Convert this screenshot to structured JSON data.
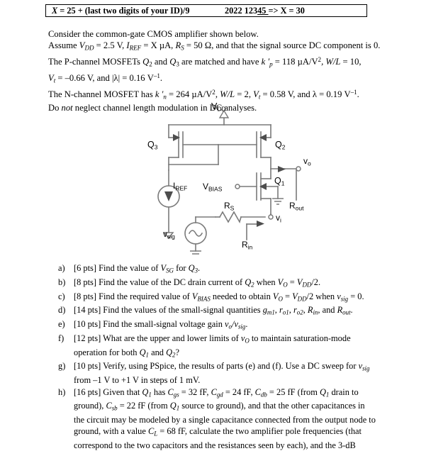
{
  "header": {
    "left_formula": "X = 25 + (last two digits of your ID)/9",
    "right_example_prefix": "2022 123",
    "right_example_underlined": "45 ",
    "right_example_suffix": "=> X = 30"
  },
  "intro": {
    "line1": "Consider the common-gate CMOS amplifier shown below.",
    "line2_parts": {
      "assume": "Assume ",
      "vdd": "V",
      "vdd_sub": "DD",
      "vdd_val": " = 2.5 V, ",
      "iref": "I",
      "iref_sub": "REF",
      "iref_val": " = X µA, ",
      "rs": "R",
      "rs_sub": "S",
      "rs_val": " = 50 Ω, and that the signal source DC component is 0."
    },
    "line3_parts": {
      "pre": "The P-channel MOSFETs ",
      "q2": "Q",
      "q2_sub": "2",
      "mid": " and ",
      "q3": "Q",
      "q3_sub": "3",
      "post": " are matched and have ",
      "kp": "k ′",
      "kp_sub": "p",
      "kp_val": " = 118 µA/V",
      "kp_exp": "2",
      "wl": ", W/L",
      "wl_val": " = 10,"
    },
    "line4_parts": {
      "vt": "V",
      "vt_sub": "t",
      "vt_val": " = –0.66 V, and |λ| = 0.16 V",
      "vt_exp": "–1",
      "end": "."
    },
    "line5_parts": {
      "pre": "The N-channel MOSFET has ",
      "kn": "k ′",
      "kn_sub": "n",
      "kn_val": " = 264 µA/V",
      "kn_exp": "2",
      "wl": ", W/L",
      "wl_val": " = 2, ",
      "vt": "V",
      "vt_sub": "t",
      "vt_val": " = 0.58 V, and λ = 0.19 V",
      "vt_exp": "–1",
      "end": "."
    },
    "line6_a": "Do ",
    "line6_b": "not",
    "line6_c": " neglect channel length modulation in DC analyses."
  },
  "circuit": {
    "vdd_label": "V",
    "vdd_sub": "DD",
    "q3_label": "Q",
    "q3_sub": "3",
    "q2_label": "Q",
    "q2_sub": "2",
    "q1_label": "Q",
    "q1_sub": "1",
    "iref_label": "I",
    "iref_sub": "REF",
    "vbias_label": "V",
    "vbias_sub": "BIAS",
    "vo_label": "v",
    "vo_sub": "o",
    "vi_label": "v",
    "vi_sub": "i",
    "rs_label": "R",
    "rs_sub": "S",
    "rout_label": "R",
    "rout_sub": "out",
    "rin_label": "R",
    "rin_sub": "in",
    "vsig_label": "v",
    "vsig_sub": "sig"
  },
  "questions": [
    {
      "letter": "a)",
      "pts": "[6 pts]",
      "lines": [
        {
          "seg": [
            {
              "t": "[6 pts] Find the value of ",
              "s": "n"
            },
            {
              "t": "V",
              "s": "i"
            },
            {
              "t": "SG",
              "s": "sub"
            },
            {
              "t": " for ",
              "s": "n"
            },
            {
              "t": "Q",
              "s": "i"
            },
            {
              "t": "3",
              "s": "sub"
            },
            {
              "t": ".",
              "s": "n"
            }
          ]
        }
      ]
    },
    {
      "letter": "b)",
      "pts": "[8 pts]",
      "lines": [
        {
          "seg": [
            {
              "t": "[8 pts] Find the value of the DC drain current of ",
              "s": "n"
            },
            {
              "t": "Q",
              "s": "i"
            },
            {
              "t": "2",
              "s": "sub"
            },
            {
              "t": " when ",
              "s": "n"
            },
            {
              "t": "V",
              "s": "i"
            },
            {
              "t": "O",
              "s": "sub"
            },
            {
              "t": " = ",
              "s": "n"
            },
            {
              "t": "V",
              "s": "i"
            },
            {
              "t": "DD",
              "s": "sub"
            },
            {
              "t": "/2.",
              "s": "n"
            }
          ]
        }
      ]
    },
    {
      "letter": "c)",
      "pts": "[8 pts]",
      "lines": [
        {
          "seg": [
            {
              "t": "[8 pts] Find the required value of ",
              "s": "n"
            },
            {
              "t": "V",
              "s": "i"
            },
            {
              "t": "BIAS",
              "s": "sub"
            },
            {
              "t": " needed to obtain ",
              "s": "n"
            },
            {
              "t": "V",
              "s": "i"
            },
            {
              "t": "O",
              "s": "sub"
            },
            {
              "t": " = ",
              "s": "n"
            },
            {
              "t": "V",
              "s": "i"
            },
            {
              "t": "DD",
              "s": "sub"
            },
            {
              "t": "/2 when ",
              "s": "n"
            },
            {
              "t": "v",
              "s": "i"
            },
            {
              "t": "sig",
              "s": "sub"
            },
            {
              "t": " = 0.",
              "s": "n"
            }
          ]
        }
      ]
    },
    {
      "letter": "d)",
      "pts": "[14 pts]",
      "lines": [
        {
          "seg": [
            {
              "t": "[14 pts] Find the values of the small-signal quantities ",
              "s": "n"
            },
            {
              "t": "g",
              "s": "i"
            },
            {
              "t": "m1",
              "s": "sub"
            },
            {
              "t": ", ",
              "s": "n"
            },
            {
              "t": "r",
              "s": "i"
            },
            {
              "t": "o1",
              "s": "sub"
            },
            {
              "t": ", ",
              "s": "n"
            },
            {
              "t": "r",
              "s": "i"
            },
            {
              "t": "o2",
              "s": "sub"
            },
            {
              "t": ", ",
              "s": "n"
            },
            {
              "t": "R",
              "s": "i"
            },
            {
              "t": "in",
              "s": "sub"
            },
            {
              "t": ", and ",
              "s": "n"
            },
            {
              "t": "R",
              "s": "i"
            },
            {
              "t": "out",
              "s": "sub"
            },
            {
              "t": ".",
              "s": "n"
            }
          ]
        }
      ]
    },
    {
      "letter": "e)",
      "pts": "[10 pts]",
      "lines": [
        {
          "seg": [
            {
              "t": "[10 pts] Find the small-signal voltage gain ",
              "s": "n"
            },
            {
              "t": "v",
              "s": "i"
            },
            {
              "t": "o",
              "s": "sub"
            },
            {
              "t": "/",
              "s": "i"
            },
            {
              "t": "v",
              "s": "i"
            },
            {
              "t": "sig",
              "s": "sub"
            },
            {
              "t": ".",
              "s": "n"
            }
          ]
        }
      ]
    },
    {
      "letter": "f)",
      "pts": "[12 pts]",
      "lines": [
        {
          "seg": [
            {
              "t": "[12 pts] What are the upper and lower limits of ",
              "s": "n"
            },
            {
              "t": "v",
              "s": "i"
            },
            {
              "t": "O",
              "s": "sub"
            },
            {
              "t": " to maintain saturation-mode",
              "s": "n"
            }
          ]
        },
        {
          "seg": [
            {
              "t": "operation for both ",
              "s": "n"
            },
            {
              "t": "Q",
              "s": "i"
            },
            {
              "t": "1",
              "s": "sub"
            },
            {
              "t": " and ",
              "s": "n"
            },
            {
              "t": "Q",
              "s": "i"
            },
            {
              "t": "2",
              "s": "sub"
            },
            {
              "t": "?",
              "s": "n"
            }
          ]
        }
      ]
    },
    {
      "letter": "g)",
      "pts": "[10 pts]",
      "lines": [
        {
          "seg": [
            {
              "t": "[10 pts] Verify, using PSpice, the results of parts (e) and (f). Use a DC sweep for ",
              "s": "n"
            },
            {
              "t": "v",
              "s": "i"
            },
            {
              "t": "sig",
              "s": "sub"
            }
          ]
        },
        {
          "seg": [
            {
              "t": "from    –1 V to +1 V   in steps of 1 mV.",
              "s": "n"
            }
          ]
        }
      ]
    },
    {
      "letter": "h)",
      "pts": "[16 pts]",
      "lines": [
        {
          "seg": [
            {
              "t": "[16 pts] Given that ",
              "s": "n"
            },
            {
              "t": "Q",
              "s": "i"
            },
            {
              "t": "1",
              "s": "sub"
            },
            {
              "t": " has ",
              "s": "n"
            },
            {
              "t": "C",
              "s": "i"
            },
            {
              "t": "gs",
              "s": "sub"
            },
            {
              "t": " = 32 fF, ",
              "s": "n"
            },
            {
              "t": "C",
              "s": "i"
            },
            {
              "t": "gd",
              "s": "sub"
            },
            {
              "t": " = 24 fF, ",
              "s": "n"
            },
            {
              "t": "C",
              "s": "i"
            },
            {
              "t": "db",
              "s": "sub"
            },
            {
              "t": " = 25 fF (from ",
              "s": "n"
            },
            {
              "t": "Q",
              "s": "i"
            },
            {
              "t": "1",
              "s": "sub"
            },
            {
              "t": " drain to",
              "s": "n"
            }
          ]
        },
        {
          "seg": [
            {
              "t": "ground), ",
              "s": "n"
            },
            {
              "t": "C",
              "s": "i"
            },
            {
              "t": "sb",
              "s": "sub"
            },
            {
              "t": " = 22 fF (from ",
              "s": "n"
            },
            {
              "t": "Q",
              "s": "i"
            },
            {
              "t": "1",
              "s": "sub"
            },
            {
              "t": " source to ground), and that the other capacitances in",
              "s": "n"
            }
          ]
        },
        {
          "seg": [
            {
              "t": "the circuit may be modeled by a single capacitance connected from the output node to",
              "s": "n"
            }
          ]
        },
        {
          "seg": [
            {
              "t": "ground, with a value ",
              "s": "n"
            },
            {
              "t": "C",
              "s": "i"
            },
            {
              "t": "L",
              "s": "sub"
            },
            {
              "t": " = 68 fF, calculate the two amplifier pole frequencies (that",
              "s": "n"
            }
          ]
        },
        {
          "seg": [
            {
              "t": "correspond to the two capacitors and the resistances seen by each), and the 3-dB",
              "s": "n"
            }
          ]
        }
      ]
    }
  ]
}
